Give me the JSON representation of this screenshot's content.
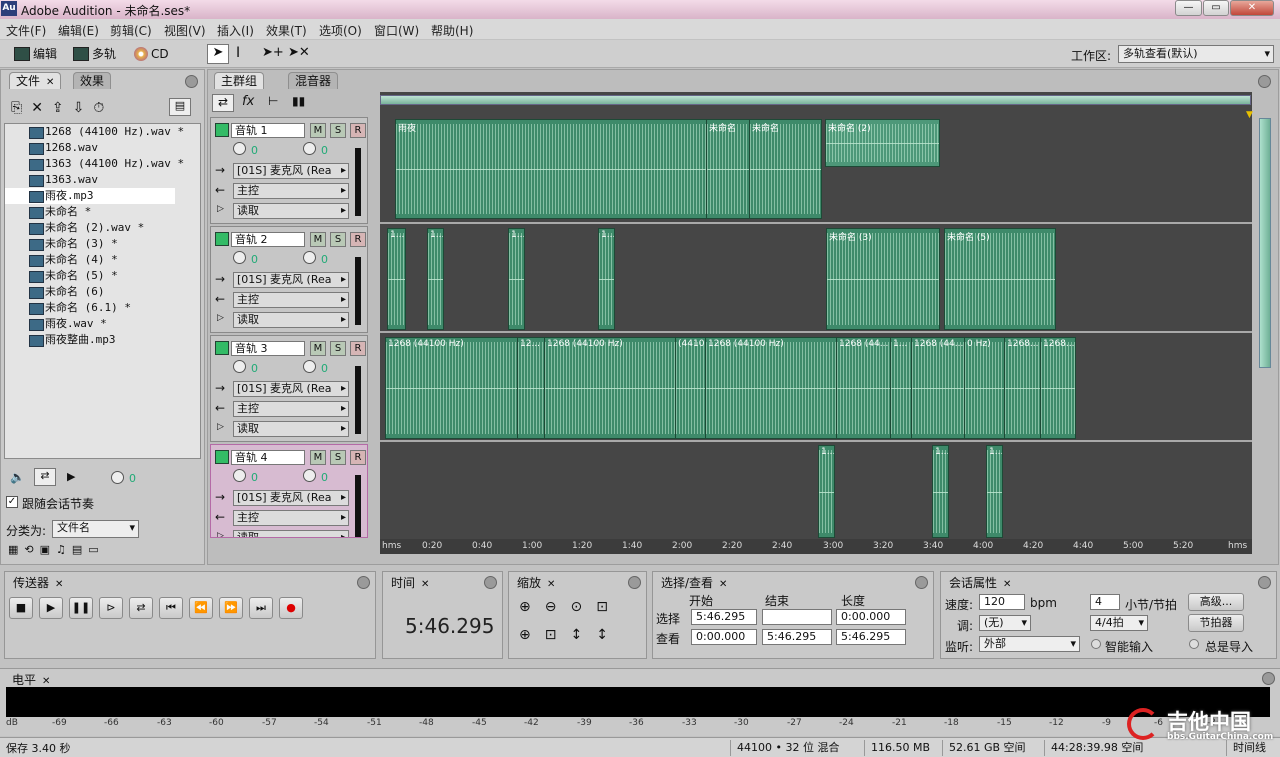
{
  "window": {
    "title": "Adobe Audition - 未命名.ses*",
    "app_icon": "Au"
  },
  "menu": [
    "文件(F)",
    "编辑(E)",
    "剪辑(C)",
    "视图(V)",
    "插入(I)",
    "效果(T)",
    "选项(O)",
    "窗口(W)",
    "帮助(H)"
  ],
  "toolbar": {
    "edit": "编辑",
    "multitrack": "多轨",
    "cd": "CD",
    "workspace_label": "工作区:",
    "workspace_value": "多轨查看(默认)"
  },
  "files_panel": {
    "tab_files": "文件",
    "tab_effects": "效果",
    "files": [
      "1268 (44100 Hz).wav *",
      "1268.wav",
      "1363 (44100 Hz).wav *",
      "1363.wav",
      "雨夜.mp3",
      "未命名 *",
      "未命名 (2).wav *",
      "未命名 (3) *",
      "未命名 (4) *",
      "未命名 (5) *",
      "未命名 (6)",
      "未命名 (6.1) *",
      "雨夜.wav *",
      "雨夜整曲.mp3"
    ],
    "volume": "0",
    "follow_label": "跟随会话节奏",
    "sort_label": "分类为:",
    "sort_value": "文件名"
  },
  "main_tabs": {
    "main": "主群组",
    "mixer": "混音器"
  },
  "tracks": [
    {
      "name": "音轨 1",
      "input": "[01S] 麦克风 (Rea",
      "output": "主控",
      "mode": "读取",
      "vol": "0",
      "pan": "0"
    },
    {
      "name": "音轨 2",
      "input": "[01S] 麦克风 (Rea",
      "output": "主控",
      "mode": "读取",
      "vol": "0",
      "pan": "0"
    },
    {
      "name": "音轨 3",
      "input": "[01S] 麦克风 (Rea",
      "output": "主控",
      "mode": "读取",
      "vol": "0",
      "pan": "0"
    },
    {
      "name": "音轨 4",
      "input": "[01S] 麦克风 (Rea",
      "output": "主控",
      "mode": "读取",
      "vol": "0",
      "pan": "0"
    }
  ],
  "msr": {
    "m": "M",
    "s": "S",
    "r": "R"
  },
  "clips": {
    "lane1": [
      "雨夜",
      "未命名",
      "未命名",
      "未命名 (2)"
    ],
    "lane2": [
      "1...",
      "1...",
      "1...",
      "1...",
      "未命名 (3)",
      "未命名 (5)"
    ],
    "lane3": [
      "1268 (44100 Hz)",
      "12...",
      "1268 (44100 Hz)",
      "(4410",
      "1268 (44100 Hz)",
      "1268 (44...",
      "1...",
      "1268 (44...",
      "0 Hz)",
      "1268...",
      "1268..."
    ],
    "lane4": [
      "1...",
      "1...",
      "1..."
    ]
  },
  "ruler": [
    "hms",
    "0:20",
    "0:40",
    "1:00",
    "1:20",
    "1:40",
    "2:00",
    "2:20",
    "2:40",
    "3:00",
    "3:20",
    "3:40",
    "4:00",
    "4:20",
    "4:40",
    "5:00",
    "5:20",
    "hms"
  ],
  "transport": {
    "title": "传送器"
  },
  "time": {
    "title": "时间",
    "value": "5:46.295"
  },
  "zoom": {
    "title": "缩放"
  },
  "selection": {
    "title": "选择/查看",
    "head_start": "开始",
    "head_end": "结束",
    "head_length": "长度",
    "sel_label": "选择",
    "view_label": "查看",
    "sel_start": "5:46.295",
    "sel_end": "",
    "sel_length": "0:00.000",
    "view_start": "0:00.000",
    "view_end": "5:46.295",
    "view_length": "5:46.295"
  },
  "session": {
    "title": "会话属性",
    "tempo_label": "速度:",
    "tempo_value": "120",
    "bpm": "bpm",
    "beats_value": "4",
    "beats_label": "小节/节拍",
    "advanced": "高级...",
    "key_label": "调:",
    "key_value": "(无)",
    "time_sig": "4/4拍",
    "metronome": "节拍器",
    "monitor_label": "监听:",
    "monitor_value": "外部",
    "smart_input": "智能输入",
    "always_import": "总是导入"
  },
  "levels": {
    "title": "电平",
    "scale": [
      "dB",
      "-69",
      "-66",
      "-63",
      "-60",
      "-57",
      "-54",
      "-51",
      "-48",
      "-45",
      "-42",
      "-39",
      "-36",
      "-33",
      "-30",
      "-27",
      "-24",
      "-21",
      "-18",
      "-15",
      "-12",
      "-9",
      "-6",
      "-3"
    ]
  },
  "status": {
    "save": "保存 3.40 秒",
    "format": "44100 • 32 位 混合",
    "ram": "116.50 MB",
    "disk": "52.61 GB 空间",
    "time_left": "44:28:39.98 空间",
    "mode": "时间线"
  },
  "watermark": {
    "name": "吉他中国",
    "url": "bbs.GuitarChina.com"
  },
  "colors": {
    "clip": "#3e8a6a",
    "track4": "#d7bbd1",
    "lane_bg": "#464646"
  }
}
